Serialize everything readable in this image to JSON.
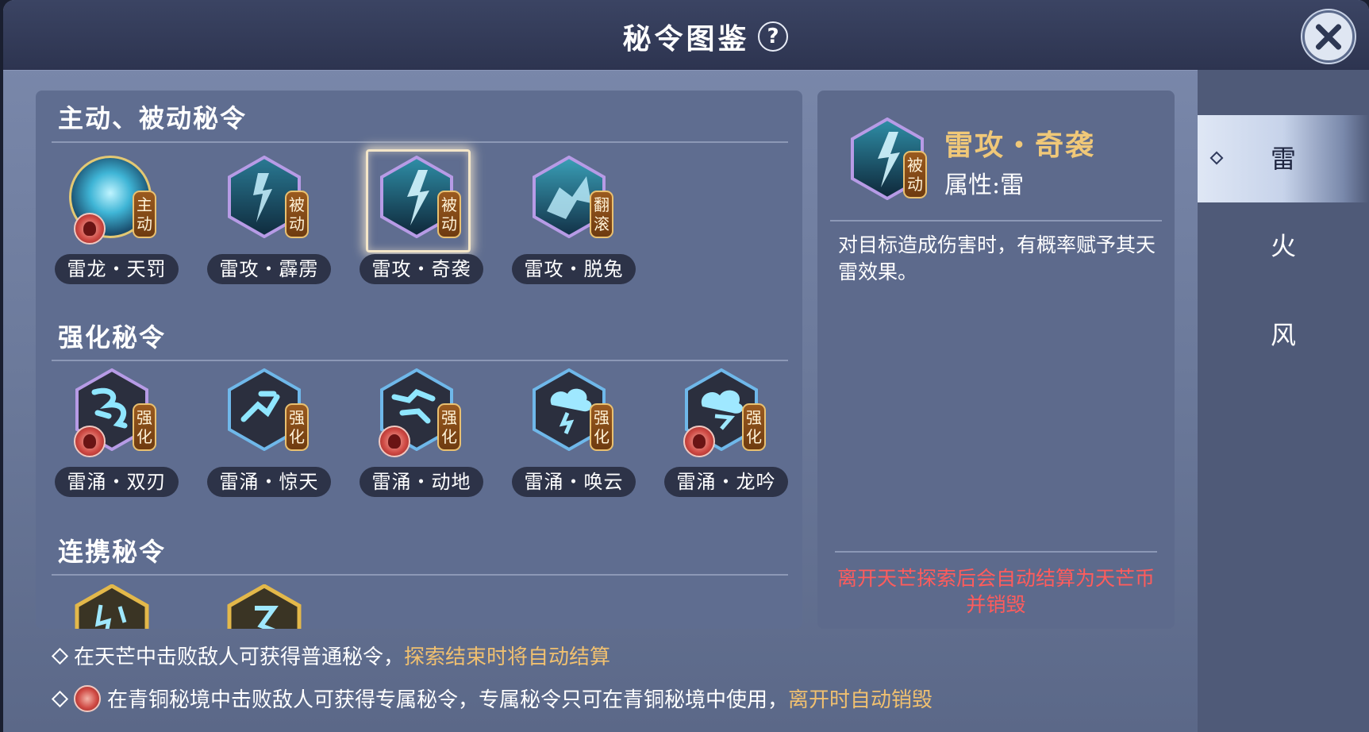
{
  "window": {
    "title": "秘令图鉴",
    "help_label": "?"
  },
  "sections": [
    {
      "title": "主动、被动秘令",
      "items": [
        {
          "name": "雷龙・天罚",
          "badge": "主动",
          "exclusive": true,
          "shape": "circle",
          "selected": false
        },
        {
          "name": "雷攻・霹雳",
          "badge": "被动",
          "exclusive": false,
          "shape": "hex",
          "selected": false
        },
        {
          "name": "雷攻・奇袭",
          "badge": "被动",
          "exclusive": false,
          "shape": "hex",
          "selected": true
        },
        {
          "name": "雷攻・脱兔",
          "badge": "翻滚",
          "exclusive": false,
          "shape": "hex",
          "selected": false
        }
      ]
    },
    {
      "title": "强化秘令",
      "items": [
        {
          "name": "雷涌・双刃",
          "badge": "强化",
          "exclusive": true,
          "frame": "purple"
        },
        {
          "name": "雷涌・惊天",
          "badge": "强化",
          "exclusive": false,
          "frame": "blue"
        },
        {
          "name": "雷涌・动地",
          "badge": "强化",
          "exclusive": true,
          "frame": "blue"
        },
        {
          "name": "雷涌・唤云",
          "badge": "强化",
          "exclusive": false,
          "frame": "blue"
        },
        {
          "name": "雷涌・龙吟",
          "badge": "强化",
          "exclusive": true,
          "frame": "blue"
        }
      ]
    },
    {
      "title": "连携秘令",
      "items": [
        {
          "frame": "gold"
        },
        {
          "frame": "gold"
        }
      ]
    }
  ],
  "detail": {
    "name": "雷攻・奇袭",
    "badge": "被动",
    "attribute": "属性:雷",
    "description": "对目标造成伤害时，有概率赋予其天雷效果。",
    "warning": "离开天芒探索后会自动结算为天芒币并销毁"
  },
  "tabs": [
    {
      "label": "雷",
      "active": true
    },
    {
      "label": "火",
      "active": false
    },
    {
      "label": "风",
      "active": false
    }
  ],
  "footer": {
    "line1_text": "在天芒中击败敌人可获得普通秘令，",
    "line1_highlight": "探索结束时将自动结算",
    "line2_text": "在青铜秘境中击败敌人可获得专属秘令，专属秘令只可在青铜秘境中使用，",
    "line2_highlight": "离开时自动销毁"
  },
  "colors": {
    "frame_purple": "#b79be6",
    "frame_blue": "#6fb8ea",
    "frame_gold": "#e3b84a",
    "highlight": "#f0c070",
    "warning": "#ff5c5c"
  }
}
